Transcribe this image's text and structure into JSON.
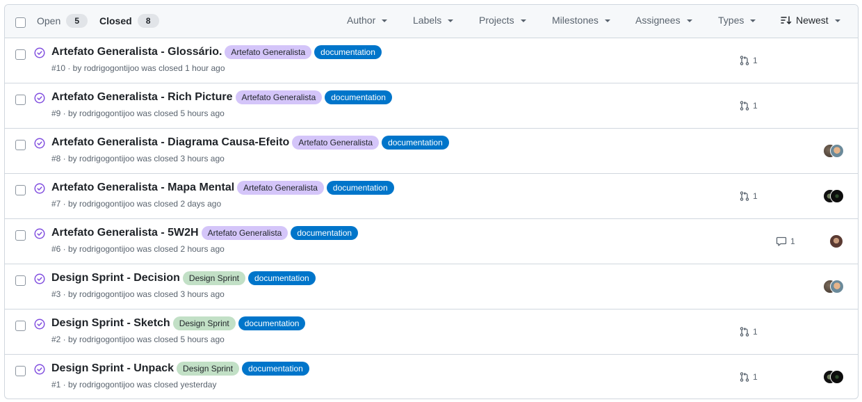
{
  "header": {
    "open_label": "Open",
    "open_count": "5",
    "closed_label": "Closed",
    "closed_count": "8",
    "filters": {
      "author": "Author",
      "labels": "Labels",
      "projects": "Projects",
      "milestones": "Milestones",
      "assignees": "Assignees",
      "types": "Types",
      "sort": "Newest"
    }
  },
  "colors": {
    "closed_icon": "#8250df",
    "label_artefato": "#d4c5f9",
    "label_design_sprint": "#c2e0c6",
    "label_documentation": "#0075ca"
  },
  "issues": [
    {
      "title": "Artefato Generalista - Glossário.",
      "labels": [
        "Artefato Generalista",
        "documentation"
      ],
      "meta": "#10 · by rodrigogontijoo was closed 1 hour ago",
      "linked_prs": "1",
      "comments": null,
      "assignees": []
    },
    {
      "title": "Artefato Generalista - Rich Picture",
      "labels": [
        "Artefato Generalista",
        "documentation"
      ],
      "meta": "#9 · by rodrigogontijoo was closed 5 hours ago",
      "linked_prs": "1",
      "comments": null,
      "assignees": []
    },
    {
      "title": "Artefato Generalista - Diagrama Causa-Efeito",
      "labels": [
        "Artefato Generalista",
        "documentation"
      ],
      "meta": "#8 · by rodrigogontijoo was closed 3 hours ago",
      "linked_prs": null,
      "comments": null,
      "assignees": [
        "avatar-a",
        "avatar-b"
      ]
    },
    {
      "title": "Artefato Generalista - Mapa Mental",
      "labels": [
        "Artefato Generalista",
        "documentation"
      ],
      "meta": "#7 · by rodrigogontijoo was closed 2 days ago",
      "linked_prs": "1",
      "comments": null,
      "assignees": [
        "avatar-c",
        "avatar-d"
      ]
    },
    {
      "title": "Artefato Generalista - 5W2H",
      "labels": [
        "Artefato Generalista",
        "documentation"
      ],
      "meta": "#6 · by rodrigogontijoo was closed 2 hours ago",
      "linked_prs": null,
      "comments": "1",
      "assignees": [
        "avatar-e"
      ]
    },
    {
      "title": "Design Sprint - Decision",
      "labels": [
        "Design Sprint",
        "documentation"
      ],
      "meta": "#3 · by rodrigogontijoo was closed 3 hours ago",
      "linked_prs": null,
      "comments": null,
      "assignees": [
        "avatar-a",
        "avatar-b"
      ]
    },
    {
      "title": "Design Sprint - Sketch",
      "labels": [
        "Design Sprint",
        "documentation"
      ],
      "meta": "#2 · by rodrigogontijoo was closed 5 hours ago",
      "linked_prs": "1",
      "comments": null,
      "assignees": []
    },
    {
      "title": "Design Sprint - Unpack",
      "labels": [
        "Design Sprint",
        "documentation"
      ],
      "meta": "#1 · by rodrigogontijoo was closed yesterday",
      "linked_prs": "1",
      "comments": null,
      "assignees": [
        "avatar-c",
        "avatar-d"
      ]
    }
  ]
}
